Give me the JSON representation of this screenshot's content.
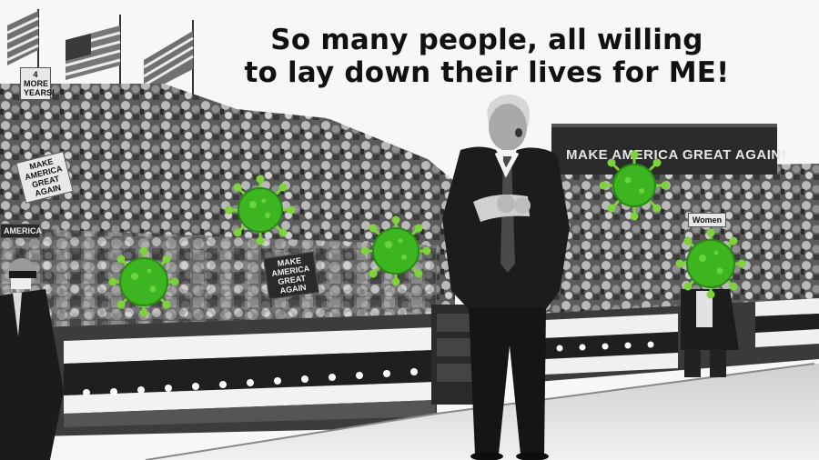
{
  "caption": {
    "line1": "So many people, all willing",
    "line2": "to lay down their lives for ME!"
  },
  "background_banner": "MAKE AMERICA GREAT AGAIN!",
  "signs": {
    "s1": "4 MORE YEARS!",
    "s2": "MAKE AMERICA GREAT AGAIN",
    "s3": "AMERICA",
    "s4": "MAKE AMERICA GREAT AGAIN",
    "s5": "Women"
  },
  "colors": {
    "virus_green": "#3cb521",
    "virus_spike": "#7ed33a",
    "photo_gray": "#8a8a8a"
  },
  "icons": [
    "virus-icon"
  ]
}
